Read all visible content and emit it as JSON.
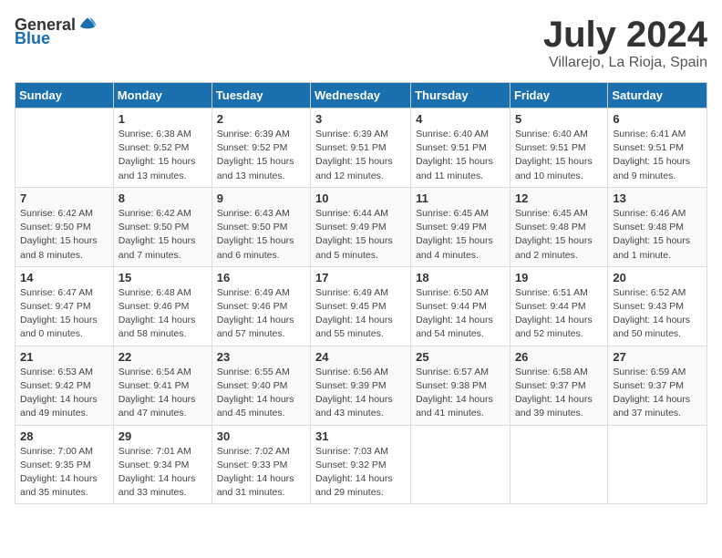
{
  "header": {
    "logo_general": "General",
    "logo_blue": "Blue",
    "month": "July 2024",
    "location": "Villarejo, La Rioja, Spain"
  },
  "weekdays": [
    "Sunday",
    "Monday",
    "Tuesday",
    "Wednesday",
    "Thursday",
    "Friday",
    "Saturday"
  ],
  "weeks": [
    [
      {
        "day": "",
        "info": ""
      },
      {
        "day": "1",
        "info": "Sunrise: 6:38 AM\nSunset: 9:52 PM\nDaylight: 15 hours\nand 13 minutes."
      },
      {
        "day": "2",
        "info": "Sunrise: 6:39 AM\nSunset: 9:52 PM\nDaylight: 15 hours\nand 13 minutes."
      },
      {
        "day": "3",
        "info": "Sunrise: 6:39 AM\nSunset: 9:51 PM\nDaylight: 15 hours\nand 12 minutes."
      },
      {
        "day": "4",
        "info": "Sunrise: 6:40 AM\nSunset: 9:51 PM\nDaylight: 15 hours\nand 11 minutes."
      },
      {
        "day": "5",
        "info": "Sunrise: 6:40 AM\nSunset: 9:51 PM\nDaylight: 15 hours\nand 10 minutes."
      },
      {
        "day": "6",
        "info": "Sunrise: 6:41 AM\nSunset: 9:51 PM\nDaylight: 15 hours\nand 9 minutes."
      }
    ],
    [
      {
        "day": "7",
        "info": "Sunrise: 6:42 AM\nSunset: 9:50 PM\nDaylight: 15 hours\nand 8 minutes."
      },
      {
        "day": "8",
        "info": "Sunrise: 6:42 AM\nSunset: 9:50 PM\nDaylight: 15 hours\nand 7 minutes."
      },
      {
        "day": "9",
        "info": "Sunrise: 6:43 AM\nSunset: 9:50 PM\nDaylight: 15 hours\nand 6 minutes."
      },
      {
        "day": "10",
        "info": "Sunrise: 6:44 AM\nSunset: 9:49 PM\nDaylight: 15 hours\nand 5 minutes."
      },
      {
        "day": "11",
        "info": "Sunrise: 6:45 AM\nSunset: 9:49 PM\nDaylight: 15 hours\nand 4 minutes."
      },
      {
        "day": "12",
        "info": "Sunrise: 6:45 AM\nSunset: 9:48 PM\nDaylight: 15 hours\nand 2 minutes."
      },
      {
        "day": "13",
        "info": "Sunrise: 6:46 AM\nSunset: 9:48 PM\nDaylight: 15 hours\nand 1 minute."
      }
    ],
    [
      {
        "day": "14",
        "info": "Sunrise: 6:47 AM\nSunset: 9:47 PM\nDaylight: 15 hours\nand 0 minutes."
      },
      {
        "day": "15",
        "info": "Sunrise: 6:48 AM\nSunset: 9:46 PM\nDaylight: 14 hours\nand 58 minutes."
      },
      {
        "day": "16",
        "info": "Sunrise: 6:49 AM\nSunset: 9:46 PM\nDaylight: 14 hours\nand 57 minutes."
      },
      {
        "day": "17",
        "info": "Sunrise: 6:49 AM\nSunset: 9:45 PM\nDaylight: 14 hours\nand 55 minutes."
      },
      {
        "day": "18",
        "info": "Sunrise: 6:50 AM\nSunset: 9:44 PM\nDaylight: 14 hours\nand 54 minutes."
      },
      {
        "day": "19",
        "info": "Sunrise: 6:51 AM\nSunset: 9:44 PM\nDaylight: 14 hours\nand 52 minutes."
      },
      {
        "day": "20",
        "info": "Sunrise: 6:52 AM\nSunset: 9:43 PM\nDaylight: 14 hours\nand 50 minutes."
      }
    ],
    [
      {
        "day": "21",
        "info": "Sunrise: 6:53 AM\nSunset: 9:42 PM\nDaylight: 14 hours\nand 49 minutes."
      },
      {
        "day": "22",
        "info": "Sunrise: 6:54 AM\nSunset: 9:41 PM\nDaylight: 14 hours\nand 47 minutes."
      },
      {
        "day": "23",
        "info": "Sunrise: 6:55 AM\nSunset: 9:40 PM\nDaylight: 14 hours\nand 45 minutes."
      },
      {
        "day": "24",
        "info": "Sunrise: 6:56 AM\nSunset: 9:39 PM\nDaylight: 14 hours\nand 43 minutes."
      },
      {
        "day": "25",
        "info": "Sunrise: 6:57 AM\nSunset: 9:38 PM\nDaylight: 14 hours\nand 41 minutes."
      },
      {
        "day": "26",
        "info": "Sunrise: 6:58 AM\nSunset: 9:37 PM\nDaylight: 14 hours\nand 39 minutes."
      },
      {
        "day": "27",
        "info": "Sunrise: 6:59 AM\nSunset: 9:37 PM\nDaylight: 14 hours\nand 37 minutes."
      }
    ],
    [
      {
        "day": "28",
        "info": "Sunrise: 7:00 AM\nSunset: 9:35 PM\nDaylight: 14 hours\nand 35 minutes."
      },
      {
        "day": "29",
        "info": "Sunrise: 7:01 AM\nSunset: 9:34 PM\nDaylight: 14 hours\nand 33 minutes."
      },
      {
        "day": "30",
        "info": "Sunrise: 7:02 AM\nSunset: 9:33 PM\nDaylight: 14 hours\nand 31 minutes."
      },
      {
        "day": "31",
        "info": "Sunrise: 7:03 AM\nSunset: 9:32 PM\nDaylight: 14 hours\nand 29 minutes."
      },
      {
        "day": "",
        "info": ""
      },
      {
        "day": "",
        "info": ""
      },
      {
        "day": "",
        "info": ""
      }
    ]
  ]
}
